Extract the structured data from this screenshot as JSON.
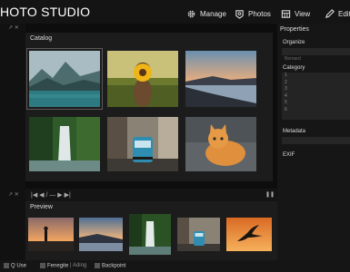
{
  "app": {
    "title": "HOTO STUDIO"
  },
  "header": {
    "tabs": [
      {
        "label": "Manage",
        "icon": "gear-icon"
      },
      {
        "label": "Photos",
        "icon": "photos-icon"
      },
      {
        "label": "View",
        "icon": "view-icon"
      },
      {
        "label": "Edit",
        "icon": "edit-icon"
      }
    ]
  },
  "panel_controls": {
    "pin": "↗ ✕"
  },
  "catalog": {
    "title": "Catalog",
    "images": [
      {
        "subject": "misty mountain lake"
      },
      {
        "subject": "woman holding sunflower in field"
      },
      {
        "subject": "beach at sunset"
      },
      {
        "subject": "waterfall in forest"
      },
      {
        "subject": "tram on city street"
      },
      {
        "subject": "orange kitten"
      }
    ]
  },
  "properties": {
    "title": "Properties",
    "organize_label": "Organize",
    "organize_value": "Bernard",
    "category_label": "Category",
    "category_items": [
      "1",
      "2",
      "3",
      "4",
      "5",
      "6"
    ],
    "metadata_label": "Metadata",
    "exif_label": "EXIF"
  },
  "navigation": {
    "controls": "|◀  ◀  / —  ▶  ▶|",
    "pause": "❚❚"
  },
  "preview": {
    "title": "Preview",
    "images": [
      {
        "subject": "person silhouette at sunset"
      },
      {
        "subject": "dusk landscape"
      },
      {
        "subject": "waterfall"
      },
      {
        "subject": "tram on street"
      },
      {
        "subject": "bird at sunset"
      }
    ]
  },
  "status": {
    "use_label": "Q Use",
    "fenfeng_label": "Fenegite",
    "fenfeng_extra": "| Ading",
    "backpoint_label": "Backpoint"
  },
  "colors": {
    "background": "#0d0d0d",
    "panel": "#1c1c1c",
    "text": "#e6e6e6"
  }
}
